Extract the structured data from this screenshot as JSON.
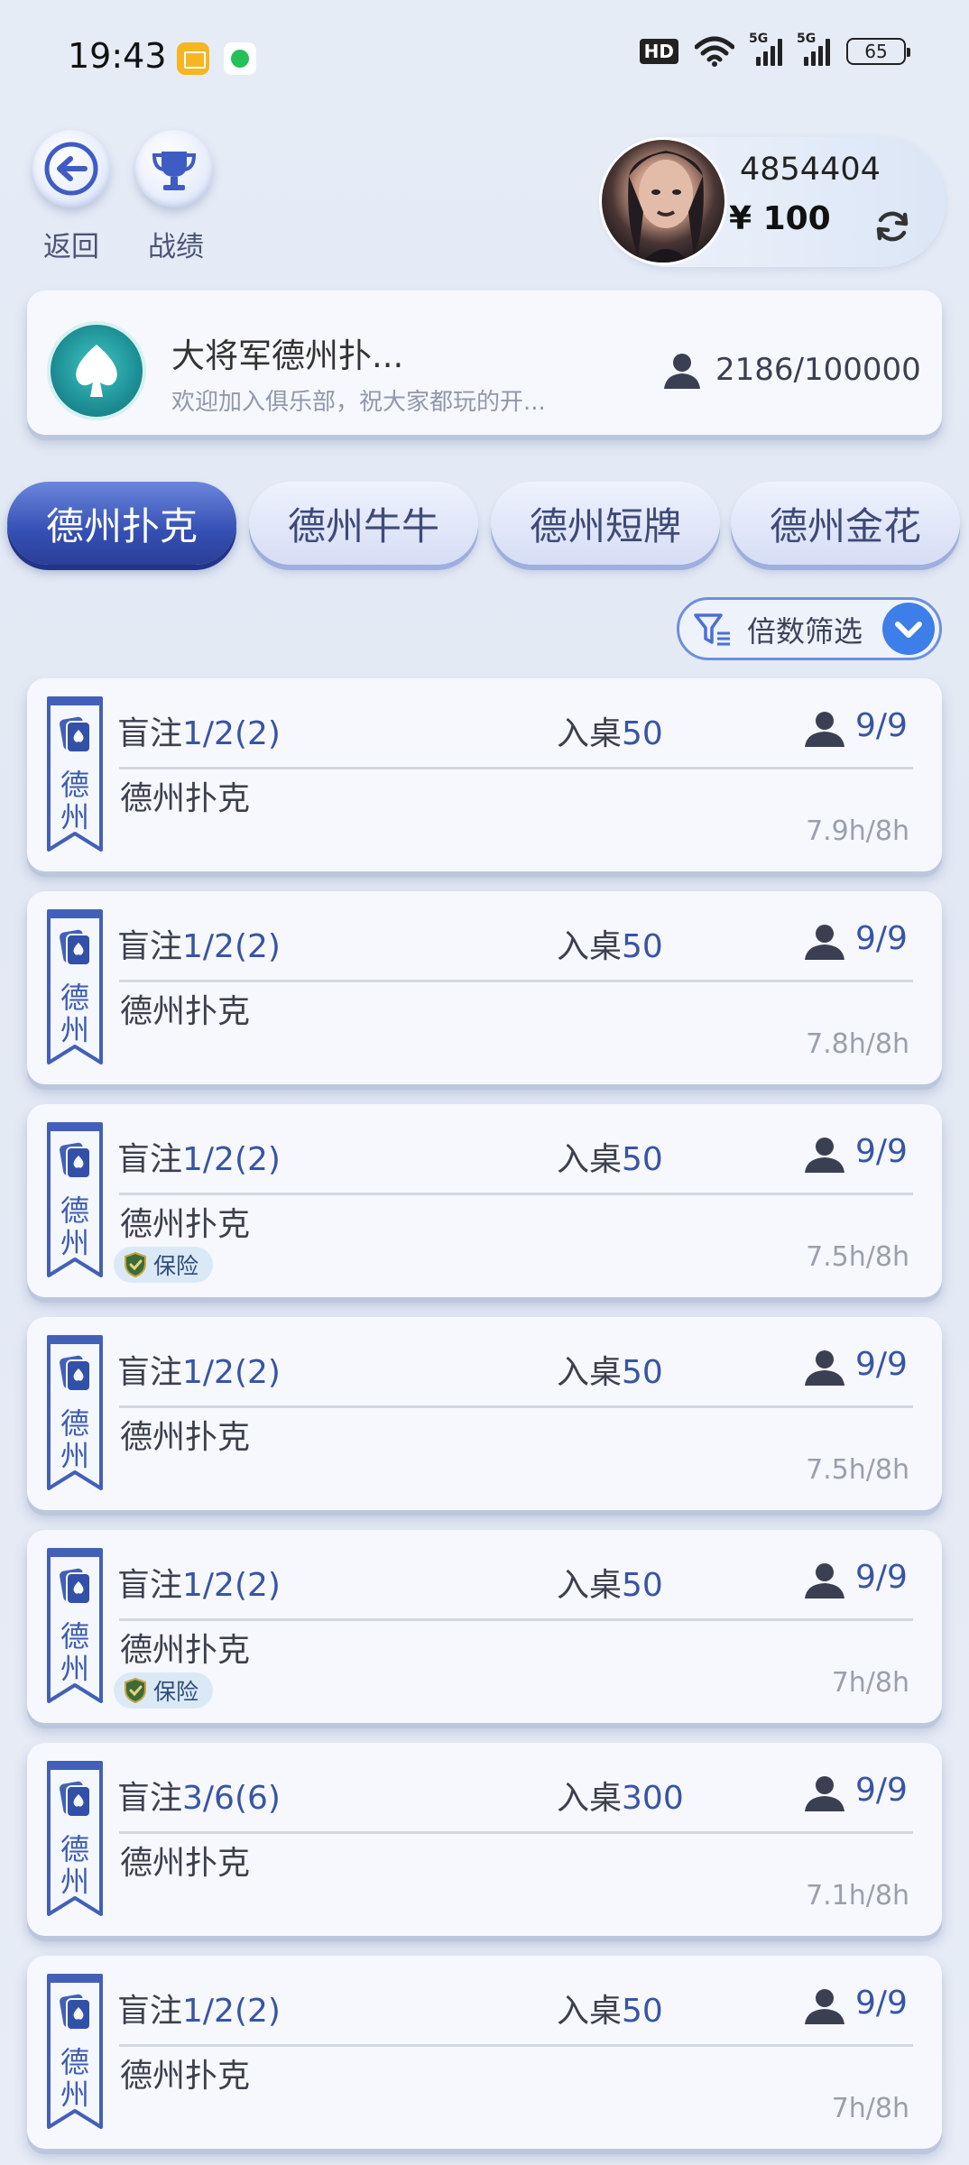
{
  "status_bar": {
    "time": "19:43",
    "hd": "HD",
    "net1": "5G",
    "net2": "5G",
    "battery": "65"
  },
  "nav": {
    "back_label": "返回",
    "record_label": "战绩"
  },
  "profile": {
    "user_id": "4854404",
    "balance": "¥ 100"
  },
  "club": {
    "name": "大将军德州扑...",
    "description": "欢迎加入俱乐部，祝大家都玩的开...",
    "members": "2186/100000"
  },
  "tabs": [
    {
      "label": "德州扑克"
    },
    {
      "label": "德州牛牛"
    },
    {
      "label": "德州短牌"
    },
    {
      "label": "德州金花"
    }
  ],
  "filter": {
    "label": "倍数筛选"
  },
  "tables": [
    {
      "badge": "德州",
      "blinds_prefix": "盲注",
      "blinds": "1/2(2)",
      "buyin_prefix": "入桌",
      "buyin": "50",
      "players": "9/9",
      "name": "德州扑克",
      "time": "7.9h/8h",
      "insurance": ""
    },
    {
      "badge": "德州",
      "blinds_prefix": "盲注",
      "blinds": "1/2(2)",
      "buyin_prefix": "入桌",
      "buyin": "50",
      "players": "9/9",
      "name": "德州扑克",
      "time": "7.8h/8h",
      "insurance": ""
    },
    {
      "badge": "德州",
      "blinds_prefix": "盲注",
      "blinds": "1/2(2)",
      "buyin_prefix": "入桌",
      "buyin": "50",
      "players": "9/9",
      "name": "德州扑克",
      "time": "7.5h/8h",
      "insurance": "保险"
    },
    {
      "badge": "德州",
      "blinds_prefix": "盲注",
      "blinds": "1/2(2)",
      "buyin_prefix": "入桌",
      "buyin": "50",
      "players": "9/9",
      "name": "德州扑克",
      "time": "7.5h/8h",
      "insurance": ""
    },
    {
      "badge": "德州",
      "blinds_prefix": "盲注",
      "blinds": "1/2(2)",
      "buyin_prefix": "入桌",
      "buyin": "50",
      "players": "9/9",
      "name": "德州扑克",
      "time": "7h/8h",
      "insurance": "保险"
    },
    {
      "badge": "德州",
      "blinds_prefix": "盲注",
      "blinds": "3/6(6)",
      "buyin_prefix": "入桌",
      "buyin": "300",
      "players": "9/9",
      "name": "德州扑克",
      "time": "7.1h/8h",
      "insurance": ""
    },
    {
      "badge": "德州",
      "blinds_prefix": "盲注",
      "blinds": "1/2(2)",
      "buyin_prefix": "入桌",
      "buyin": "50",
      "players": "9/9",
      "name": "德州扑克",
      "time": "7h/8h",
      "insurance": ""
    }
  ],
  "colors": {
    "accent": "#3754a6",
    "tab_active": "#3550b3",
    "filter_check": "#3d7ee8"
  }
}
